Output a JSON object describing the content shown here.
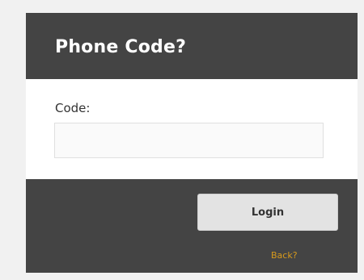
{
  "dialog": {
    "title": "Phone Code?",
    "code_field": {
      "label": "Code:",
      "value": "",
      "placeholder": ""
    },
    "login_label": "Login",
    "back_label": "Back?"
  },
  "colors": {
    "page_background": "#f1f1f1",
    "panel_dark": "#444444",
    "panel_light": "#ffffff",
    "button_background": "#e3e3e3",
    "link": "#d79a1c"
  }
}
